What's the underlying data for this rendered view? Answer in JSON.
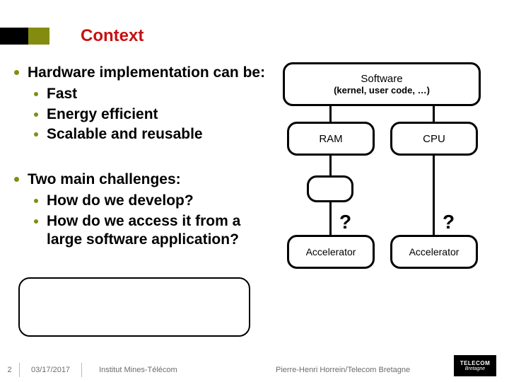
{
  "title": "Context",
  "bullets": {
    "b1": {
      "text": "Hardware implementation can be:",
      "subs": [
        "Fast",
        "Energy efficient",
        "Scalable and reusable"
      ]
    },
    "b2": {
      "text": "Two main challenges:",
      "subs": [
        "How do we develop?",
        "How do we access it from a large software application?"
      ]
    }
  },
  "diagram": {
    "software_l1": "Software",
    "software_l2": "(kernel, user code, …)",
    "ram": "RAM",
    "cpu": "CPU",
    "q": "?",
    "acc1": "Accelerator",
    "acc2": "Accelerator"
  },
  "footer": {
    "page": "2",
    "date": "03/17/2017",
    "inst": "Institut Mines-Télécom",
    "author": "Pierre-Henri Horrein/Telecom Bretagne",
    "logo_l1": "TELECOM",
    "logo_l2": "Bretagne"
  }
}
